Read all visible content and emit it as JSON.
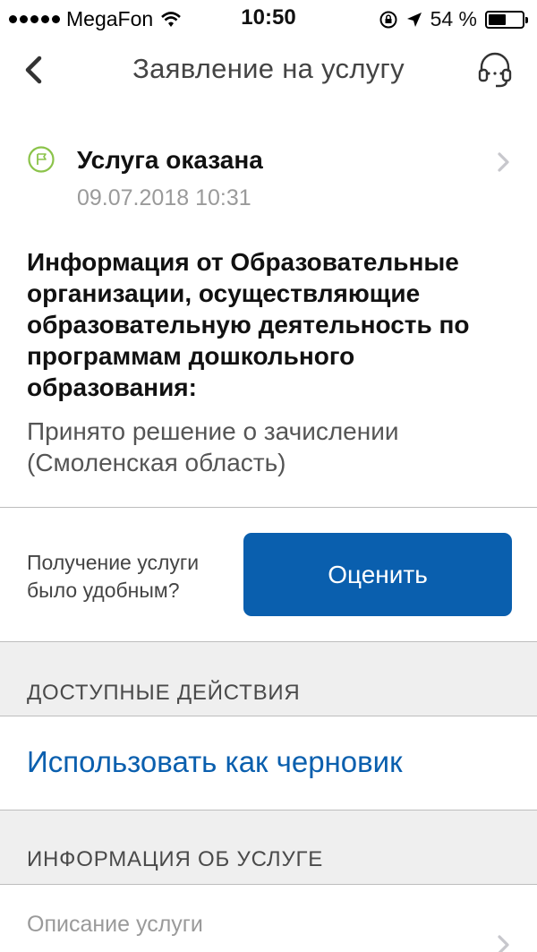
{
  "status_bar": {
    "carrier": "MegaFon",
    "time": "10:50",
    "battery": "54 %",
    "battery_level": 0.54
  },
  "nav": {
    "title": "Заявление на услугу"
  },
  "service_status": {
    "title": "Услуга оказана",
    "date": "09.07.2018 10:31",
    "accent_color": "#8bc34a"
  },
  "info": {
    "heading": "Информация от Образовательные организации, осуществляющие образовательную деятельность по программам дошкольного образования:",
    "text": "Принято решение о зачислении (Смоленская область)"
  },
  "rating": {
    "question": "Получение услуги было удобным?",
    "button_label": "Оценить",
    "button_color": "#0a5fae"
  },
  "actions_section": {
    "header": "ДОСТУПНЫЕ ДЕЙСТВИЯ",
    "items": [
      {
        "label": "Использовать как черновик"
      }
    ]
  },
  "info_section": {
    "header": "ИНФОРМАЦИЯ ОБ УСЛУГЕ",
    "description_label": "Описание услуги"
  }
}
